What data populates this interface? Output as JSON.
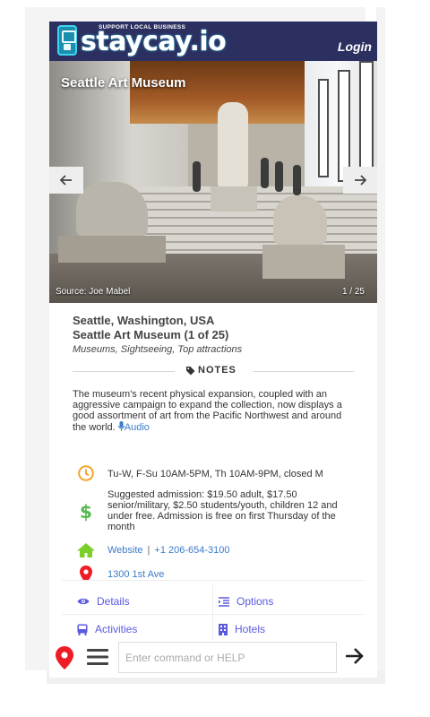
{
  "header": {
    "tagline": "SUPPORT LOCAL BUSINESS",
    "brand": "staycay.io",
    "login_label": "Login"
  },
  "gallery": {
    "title": "Seattle Art Museum",
    "source": "Source: Joe Mabel",
    "counter": "1 / 25",
    "prev_icon": "arrow-left-icon",
    "next_icon": "arrow-right-icon"
  },
  "place": {
    "location": "Seattle, Washington, USA",
    "name": "Seattle Art Museum (1 of 25)",
    "categories": "Museums, Sightseeing, Top attractions"
  },
  "notes": {
    "label": "NOTES",
    "description": "The museum's recent physical expansion, coupled with an aggressive campaign to expand the collection, now displays a good assortment of art from the Pacific Northwest and around the world.",
    "audio_label": "Audio"
  },
  "details": {
    "hours": "Tu-W, F-Su 10AM-5PM, Th 10AM-9PM, closed M",
    "admission": "Suggested admission: $19.50 adult, $17.50 senior/military, $2.50 students/youth, children 12 and under free. Admission is free on first Thursday of the month",
    "website_label": "Website",
    "separator": "|",
    "phone": "+1 206-654-3100",
    "address": "1300 1st Ave"
  },
  "menu": {
    "details_label": "Details",
    "options_label": "Options",
    "activities_label": "Activities",
    "hotels_label": "Hotels"
  },
  "command": {
    "placeholder": "Enter command or HELP",
    "value": ""
  },
  "colors": {
    "header_bg": "#2c3060",
    "clock": "#f0a52b",
    "dollar": "#55b84a",
    "home": "#7ad028",
    "pin": "#ee1c25",
    "link": "#3b7bc9",
    "menu_link": "#5a5ae0"
  }
}
